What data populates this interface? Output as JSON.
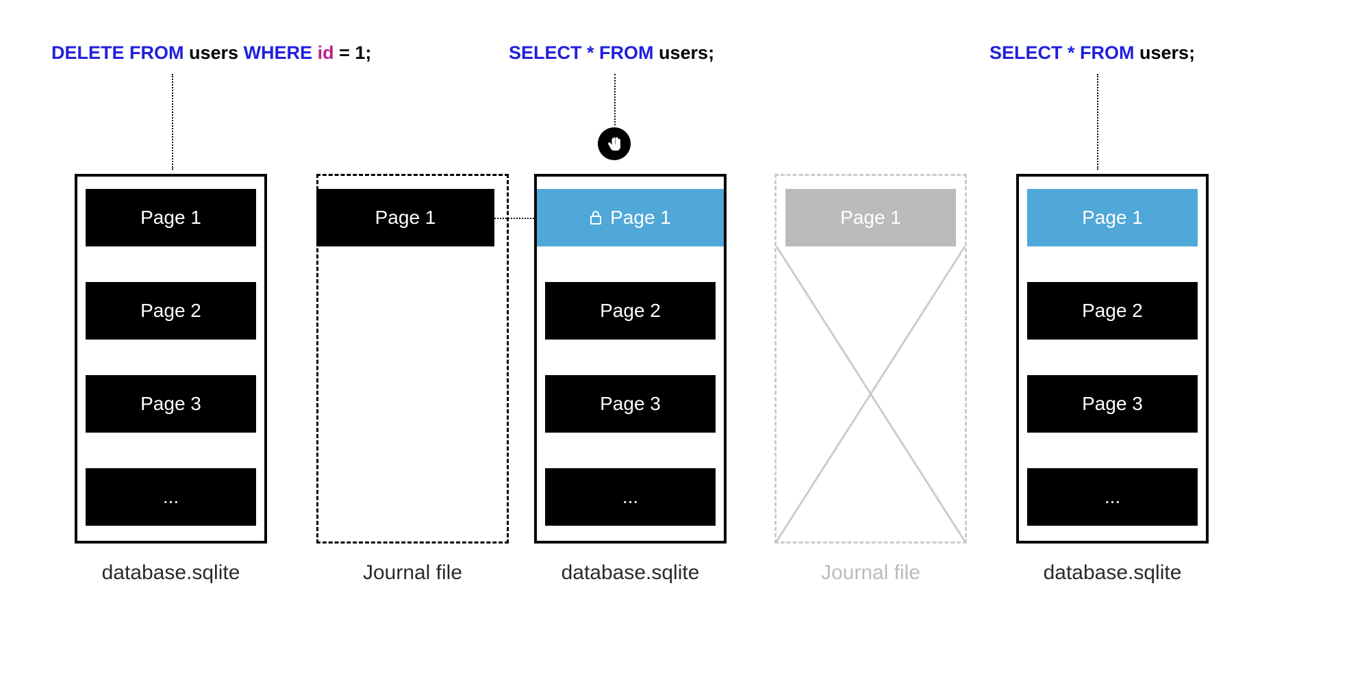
{
  "queries": {
    "q1": {
      "delete": "DELETE FROM",
      "table": " users ",
      "where": "WHERE",
      "col": " id",
      "eq": " = 1;"
    },
    "q2": {
      "select": "SELECT * FROM",
      "table": " users;"
    },
    "q3": {
      "select": "SELECT * FROM",
      "table": " users;"
    }
  },
  "boxes": {
    "db1": {
      "caption": "database.sqlite",
      "pages": [
        "Page 1",
        "Page 2",
        "Page 3",
        "..."
      ]
    },
    "journal1": {
      "caption": "Journal file",
      "pages": [
        "Page 1"
      ]
    },
    "db2": {
      "caption": "database.sqlite",
      "pages": [
        "Page 1",
        "Page 2",
        "Page 3",
        "..."
      ]
    },
    "journal2": {
      "caption": "Journal file",
      "pages": [
        "Page 1"
      ]
    },
    "db3": {
      "caption": "database.sqlite",
      "pages": [
        "Page 1",
        "Page 2",
        "Page 3",
        "..."
      ]
    }
  },
  "icons": {
    "stop": "✋",
    "lock": "🔒"
  },
  "colors": {
    "blue_page": "#4fa8d8",
    "keyword": "#2020dd",
    "column": "#bb2288",
    "ghost": "#cccccc"
  }
}
